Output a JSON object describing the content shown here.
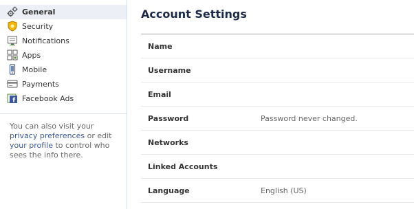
{
  "sidebar": {
    "items": [
      {
        "label": "General",
        "icon": "gears-icon",
        "selected": true
      },
      {
        "label": "Security",
        "icon": "security-badge-icon",
        "selected": false
      },
      {
        "label": "Notifications",
        "icon": "notifications-icon",
        "selected": false
      },
      {
        "label": "Apps",
        "icon": "apps-icon",
        "selected": false
      },
      {
        "label": "Mobile",
        "icon": "mobile-phone-icon",
        "selected": false
      },
      {
        "label": "Payments",
        "icon": "credit-card-icon",
        "selected": false
      },
      {
        "label": "Facebook Ads",
        "icon": "facebook-ads-icon",
        "selected": false
      }
    ],
    "note": {
      "prefix": "You can also visit your ",
      "privacy_link": "privacy preferences",
      "middle": " or edit ",
      "profile_link": "your profile",
      "suffix": " to control who sees the info there."
    }
  },
  "main": {
    "title": "Account Settings",
    "rows": [
      {
        "label": "Name",
        "value": ""
      },
      {
        "label": "Username",
        "value": ""
      },
      {
        "label": "Email",
        "value": ""
      },
      {
        "label": "Password",
        "value": "Password never changed."
      },
      {
        "label": "Networks",
        "value": ""
      },
      {
        "label": "Linked Accounts",
        "value": ""
      },
      {
        "label": "Language",
        "value": "English (US)"
      }
    ]
  },
  "colors": {
    "link": "#3b5998",
    "title": "#1c2a47",
    "selected_bg": "#eceff5",
    "divider": "#d8dfea"
  }
}
